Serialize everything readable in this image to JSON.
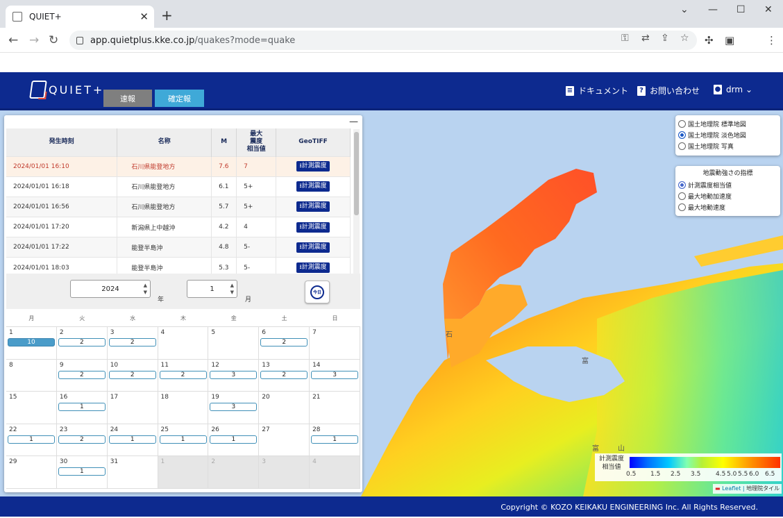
{
  "browser": {
    "tab_title": "QUIET+",
    "tab_close": "✕",
    "new_tab": "+",
    "url_host": "app.quietplus.kke.co.jp",
    "url_path": "/quakes?mode=quake"
  },
  "header": {
    "logo_text": "QUIET+",
    "tab_sokuho": "速報",
    "tab_kakuteiho": "確定報",
    "doc_link": "ドキュメント",
    "contact_link": "お問い合わせ",
    "user": "drm"
  },
  "quake_table": {
    "headers": {
      "time": "発生時刻",
      "name": "名称",
      "m": "M",
      "max_a": "最大",
      "max_b": "震度",
      "max_c": "相当値",
      "geotiff": "GeoTIFF"
    },
    "rows": [
      {
        "time": "2024/01/01 16:10",
        "name": "石川県能登地方",
        "m": "7.6",
        "intensity": "7",
        "geotiff": "計測震度"
      },
      {
        "time": "2024/01/01 16:18",
        "name": "石川県能登地方",
        "m": "6.1",
        "intensity": "5+",
        "geotiff": "計測震度"
      },
      {
        "time": "2024/01/01 16:56",
        "name": "石川県能登地方",
        "m": "5.7",
        "intensity": "5+",
        "geotiff": "計測震度"
      },
      {
        "time": "2024/01/01 17:20",
        "name": "新潟県上中越沖",
        "m": "4.2",
        "intensity": "4",
        "geotiff": "計測震度"
      },
      {
        "time": "2024/01/01 17:22",
        "name": "能登半島沖",
        "m": "4.8",
        "intensity": "5-",
        "geotiff": "計測震度"
      },
      {
        "time": "2024/01/01 18:03",
        "name": "能登半島沖",
        "m": "5.3",
        "intensity": "5-",
        "geotiff": "計測震度"
      }
    ]
  },
  "calendar_controls": {
    "year": "2024",
    "year_unit": "年",
    "month": "1",
    "month_unit": "月",
    "today_label": "今日"
  },
  "calendar": {
    "weekdays": [
      "月",
      "火",
      "水",
      "木",
      "金",
      "土",
      "日"
    ],
    "weeks": [
      [
        {
          "d": "1",
          "c": "10",
          "hot": true
        },
        {
          "d": "2",
          "c": "2"
        },
        {
          "d": "3",
          "c": "2"
        },
        {
          "d": "4",
          "c": ""
        },
        {
          "d": "5",
          "c": ""
        },
        {
          "d": "6",
          "c": "2"
        },
        {
          "d": "7",
          "c": ""
        }
      ],
      [
        {
          "d": "8",
          "c": ""
        },
        {
          "d": "9",
          "c": "2"
        },
        {
          "d": "10",
          "c": "2"
        },
        {
          "d": "11",
          "c": "2"
        },
        {
          "d": "12",
          "c": "3"
        },
        {
          "d": "13",
          "c": "2"
        },
        {
          "d": "14",
          "c": "3"
        }
      ],
      [
        {
          "d": "15",
          "c": ""
        },
        {
          "d": "16",
          "c": "1"
        },
        {
          "d": "17",
          "c": ""
        },
        {
          "d": "18",
          "c": ""
        },
        {
          "d": "19",
          "c": "3"
        },
        {
          "d": "20",
          "c": ""
        },
        {
          "d": "21",
          "c": ""
        }
      ],
      [
        {
          "d": "22",
          "c": "1"
        },
        {
          "d": "23",
          "c": "2"
        },
        {
          "d": "24",
          "c": "1"
        },
        {
          "d": "25",
          "c": "1"
        },
        {
          "d": "26",
          "c": "1"
        },
        {
          "d": "27",
          "c": ""
        },
        {
          "d": "28",
          "c": "1"
        }
      ],
      [
        {
          "d": "29",
          "c": ""
        },
        {
          "d": "30",
          "c": "1"
        },
        {
          "d": "31",
          "c": ""
        },
        {
          "d": "1",
          "c": "",
          "other": true
        },
        {
          "d": "2",
          "c": "",
          "other": true
        },
        {
          "d": "3",
          "c": "",
          "other": true
        },
        {
          "d": "4",
          "c": "",
          "other": true
        }
      ]
    ]
  },
  "map": {
    "basemaps": [
      "国土地理院 標準地図",
      "国土地理院 淡色地図",
      "国土地理院 写真"
    ],
    "basemap_selected": 1,
    "index_title": "地震動強さの指標",
    "indices": [
      "計測震度相当値",
      "最大地動加速度",
      "最大地動速度"
    ],
    "index_selected": 0,
    "place_labels": {
      "ishikawa": "石",
      "kanazawa_area": "富",
      "toyama": "富",
      "yama": "山"
    },
    "legend_title_a": "計測震度",
    "legend_title_b": "相当値",
    "legend_ticks": [
      "0.5",
      "1.5",
      "2.5",
      "3.5",
      "4.5",
      "5.0",
      "5.5",
      "6.0",
      "6.5"
    ],
    "attribution_leaflet": "Leaflet",
    "attribution_gsi": "地理院タイル"
  },
  "footer": {
    "copyright": "Copyright © KOZO KEIKAKU ENGINEERING Inc. All Rights Reserved."
  },
  "colors": {
    "header_blue": "#0d2a8f",
    "tab_active": "#3fa9d8",
    "tab_inactive": "#7f7f7f",
    "selected_row_text": "#c0392b",
    "calendar_hot": "#4a9cc9"
  }
}
